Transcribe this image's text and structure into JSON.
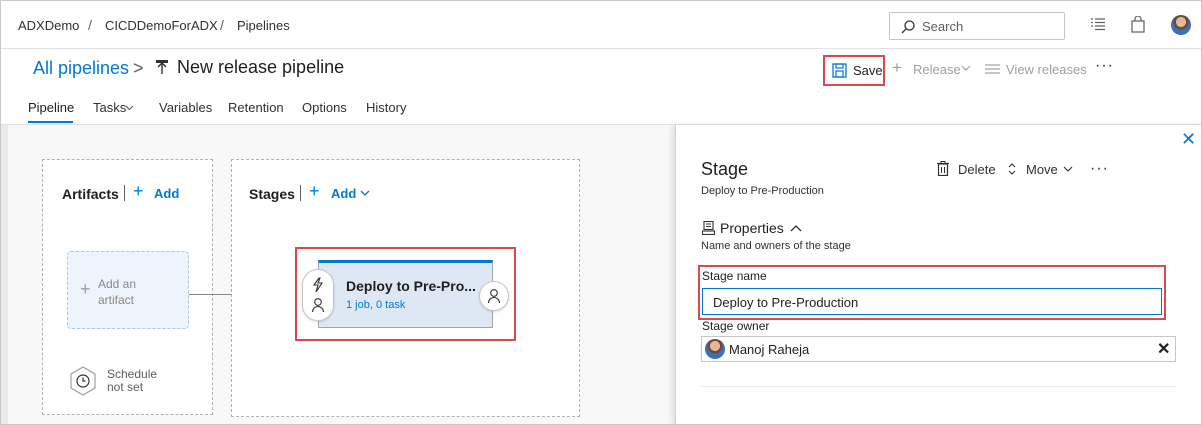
{
  "breadcrumb": [
    "ADXDemo",
    "CICDDemoForADX",
    "Pipelines"
  ],
  "search": {
    "placeholder": "Search"
  },
  "header": {
    "all_pipelines": "All pipelines",
    "title": "New release pipeline",
    "save": "Save",
    "release": "Release",
    "view_releases": "View releases",
    "more": "···"
  },
  "tabs": [
    "Pipeline",
    "Tasks",
    "Variables",
    "Retention",
    "Options",
    "History"
  ],
  "artifacts": {
    "title": "Artifacts",
    "add": "Add",
    "placeholder_line1": "Add an",
    "placeholder_line2": "artifact",
    "schedule_line1": "Schedule",
    "schedule_line2": "not set"
  },
  "stages": {
    "title": "Stages",
    "add": "Add",
    "card_name": "Deploy to Pre-Pro...",
    "card_meta": "1 job, 0 task"
  },
  "panel": {
    "title": "Stage",
    "subtitle": "Deploy to Pre-Production",
    "delete": "Delete",
    "move": "Move",
    "more": "···",
    "properties": "Properties",
    "properties_sub": "Name and owners of the stage",
    "stage_name_label": "Stage name",
    "stage_name_value": "Deploy to Pre-Production",
    "stage_owner_label": "Stage owner",
    "owner_name": "Manoj Raheja"
  },
  "colors": {
    "accent": "#0078d4",
    "highlight": "#e0474c",
    "stage_fill": "#dde8f4"
  }
}
